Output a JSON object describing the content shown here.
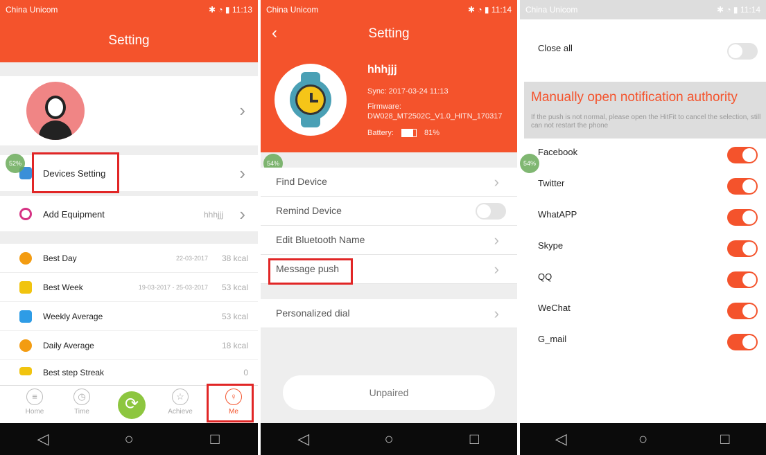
{
  "status": {
    "carrier": "China Unicom",
    "time1": "11:13",
    "time2": "11:14",
    "time3": "11:14"
  },
  "panel1": {
    "title": "Setting",
    "devices_setting": "Devices Setting",
    "add_equipment": "Add Equipment",
    "add_equipment_value": "hhhjjj",
    "stats": [
      {
        "label": "Best Day",
        "date": "22-03-2017",
        "value": "38 kcal"
      },
      {
        "label": "Best Week",
        "date": "19-03-2017 - 25-03-2017",
        "value": "53 kcal"
      },
      {
        "label": "Weekly Average",
        "date": "",
        "value": "53 kcal"
      },
      {
        "label": "Daily Average",
        "date": "",
        "value": "18 kcal"
      },
      {
        "label": "Best step Streak",
        "date": "",
        "value": "0"
      }
    ],
    "badge": "52%",
    "tabs": {
      "home": "Home",
      "time": "Time",
      "achieve": "Achieve",
      "me": "Me"
    }
  },
  "panel2": {
    "title": "Setting",
    "device_name": "hhhjjj",
    "sync": "Sync: 2017-03-24 11:13",
    "firmware_label": "Firmware:",
    "firmware": "DW028_MT2502C_V1.0_HITN_170317",
    "battery_label": "Battery:",
    "battery": "81%",
    "battery_level": 0.81,
    "badge": "54%",
    "rows": {
      "find_device": "Find Device",
      "remind_device": "Remind Device",
      "edit_bt_name": "Edit Bluetooth Name",
      "message_push": "Message push",
      "personalized_dial": "Personalized dial"
    },
    "unpaired": "Unpaired"
  },
  "panel3": {
    "close_all": "Close all",
    "manual_title": "Manually open notification authority",
    "manual_desc": "If the push is not normal, please open the HitFit to cancel the selection, still can not restart the phone",
    "badge": "54%",
    "apps": [
      "Facebook",
      "Twitter",
      "WhatAPP",
      "Skype",
      "QQ",
      "WeChat",
      "G_mail"
    ]
  },
  "colors": {
    "accent": "#f4532c",
    "highlight": "#e12626",
    "sync": "#8dc63f"
  }
}
